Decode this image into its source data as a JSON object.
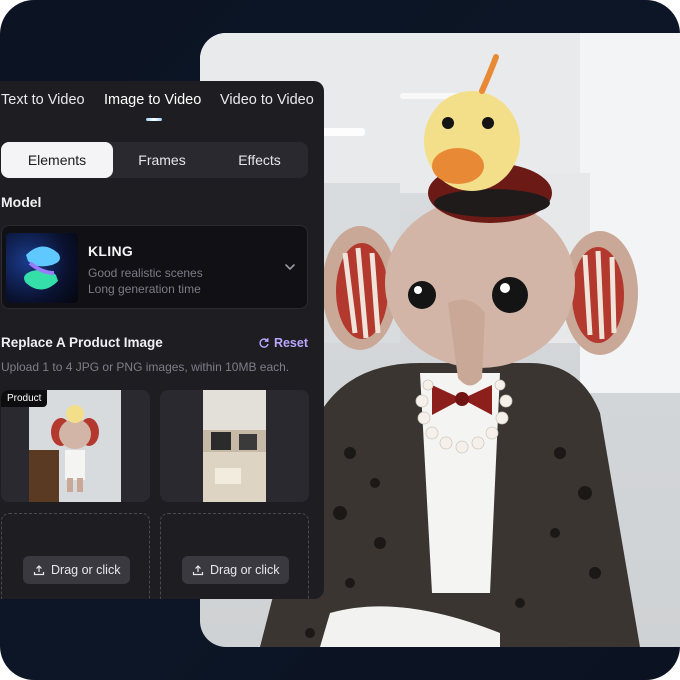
{
  "tabs": {
    "items": [
      {
        "label": "Text to Video"
      },
      {
        "label": "Image to Video"
      },
      {
        "label": "Video to Video"
      }
    ],
    "active": "Image to Video"
  },
  "subtabs": {
    "items": [
      {
        "label": "Elements"
      },
      {
        "label": "Frames"
      },
      {
        "label": "Effects"
      }
    ],
    "active": "Elements"
  },
  "model": {
    "section_label": "Model",
    "name": "KLING",
    "desc1": "Good realistic scenes",
    "desc2": "Long generation time",
    "icon": "chevron-down-icon"
  },
  "replace": {
    "title": "Replace A Product Image",
    "reset_label": "Reset",
    "hint": "Upload 1 to 4 JPG or PNG images, within 10MB each."
  },
  "slots": [
    {
      "tag": "Product"
    },
    {
      "tag": ""
    }
  ],
  "upload": [
    {
      "label": "Drag or click"
    },
    {
      "label": "Drag or click"
    }
  ],
  "colors": {
    "accent": "#b8a6ff",
    "panel": "#1e1d22",
    "frame": "#0c1424"
  }
}
